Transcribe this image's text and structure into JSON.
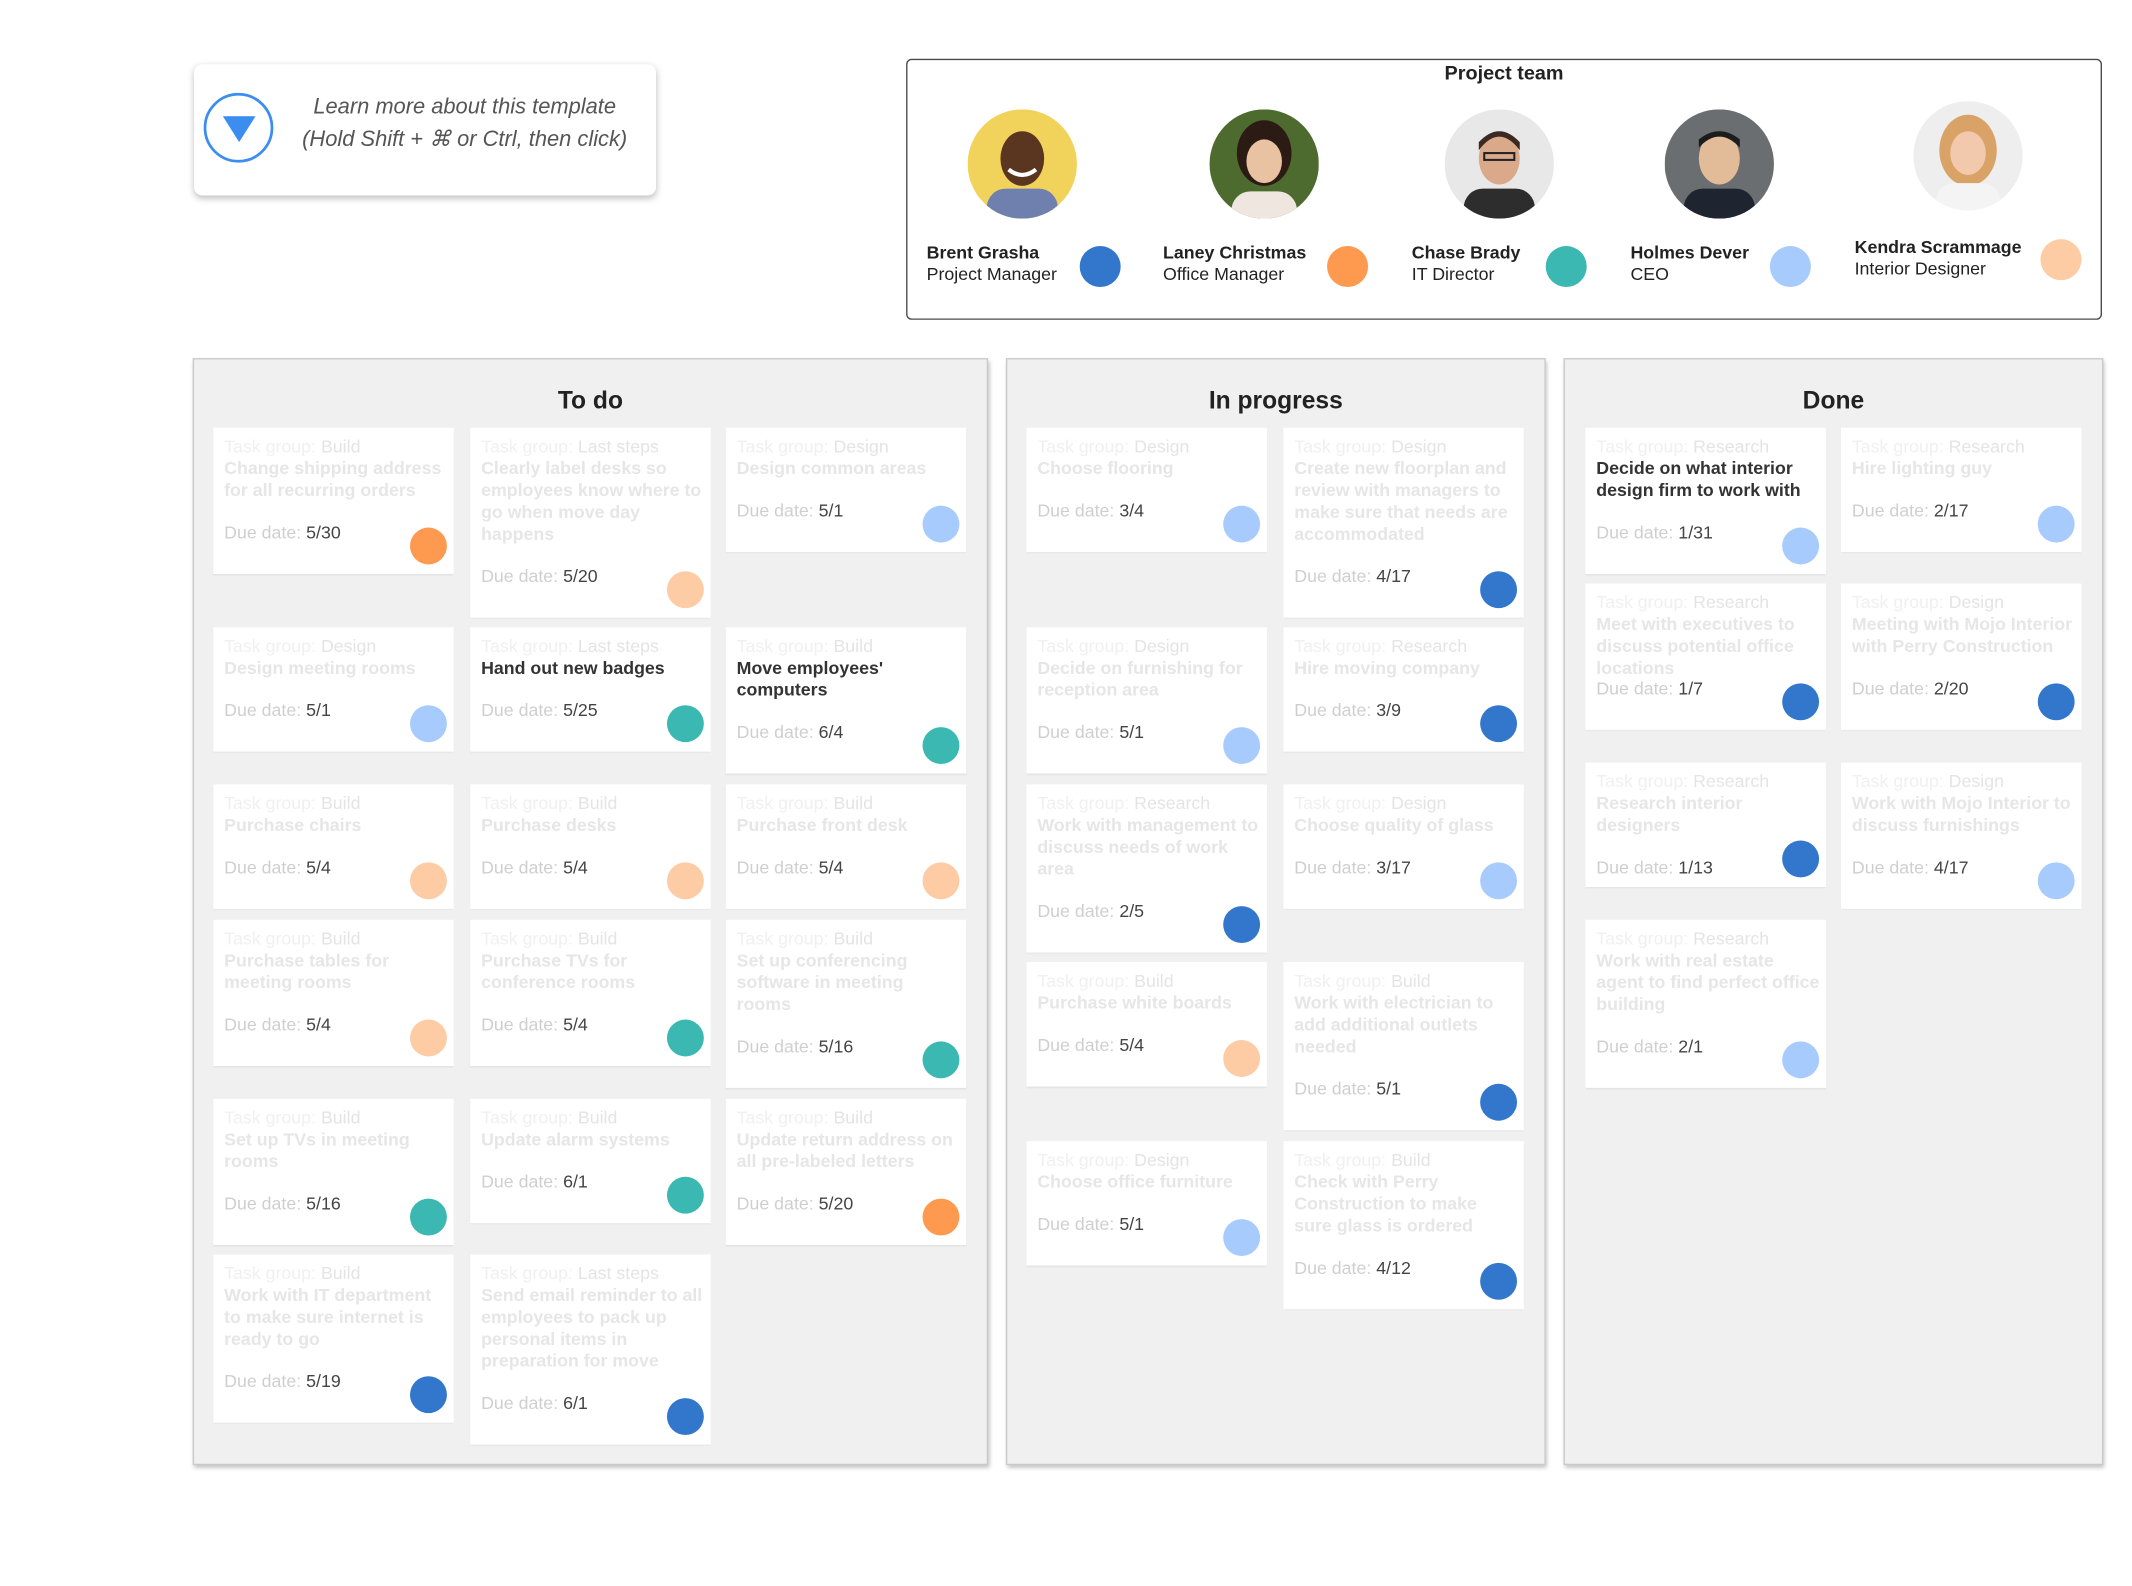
{
  "colors": {
    "dark_blue": "#3277cc",
    "orange": "#fd9a50",
    "teal": "#3cb8b2",
    "light_blue": "#a8cbfd",
    "peach": "#fdcba4"
  },
  "learn_more": {
    "line1": "Learn more about this template",
    "line2": "(Hold Shift + ⌘ or Ctrl, then click)",
    "icon": "triangle-down-icon"
  },
  "team": {
    "title": "Project team",
    "members": [
      {
        "name": "Brent Grasha",
        "role": "Project Manager",
        "color": "#3277cc"
      },
      {
        "name": "Laney Christmas",
        "role": "Office Manager",
        "color": "#fd9a50"
      },
      {
        "name": "Chase Brady",
        "role": "IT Director",
        "color": "#3cb8b2"
      },
      {
        "name": "Holmes Dever",
        "role": "CEO",
        "color": "#a8cbfd"
      },
      {
        "name": "Kendra Scrammage",
        "role": "Interior Designer",
        "color": "#fdcba4"
      }
    ]
  },
  "labels": {
    "group": "Task group:",
    "due": "Due date:"
  },
  "columns": [
    {
      "title": "To do",
      "cards": [
        {
          "group": "Build",
          "title": "Change shipping address for all recurring orders",
          "due": "5/30",
          "color": "#fd9a50"
        },
        {
          "group": "Last steps",
          "title": "Clearly label desks so employees know where to go when move day happens",
          "due": "5/20",
          "color": "#fdcba4"
        },
        {
          "group": "Design",
          "title": "Design common areas",
          "due": "5/1",
          "color": "#a8cbfd"
        },
        {
          "group": "Design",
          "title": "Design meeting rooms",
          "due": "5/1",
          "color": "#a8cbfd"
        },
        {
          "group": "Last steps",
          "title": "Hand out new badges",
          "due": "5/25",
          "color": "#3cb8b2"
        },
        {
          "group": "Build",
          "title": "Move employees' computers",
          "due": "6/4",
          "color": "#3cb8b2"
        },
        {
          "group": "Build",
          "title": "Purchase chairs",
          "due": "5/4",
          "color": "#fdcba4"
        },
        {
          "group": "Build",
          "title": "Purchase desks",
          "due": "5/4",
          "color": "#fdcba4"
        },
        {
          "group": "Build",
          "title": "Purchase front desk",
          "due": "5/4",
          "color": "#fdcba4"
        },
        {
          "group": "Build",
          "title": "Purchase tables for meeting rooms",
          "due": "5/4",
          "color": "#fdcba4"
        },
        {
          "group": "Build",
          "title": "Purchase TVs for conference rooms",
          "due": "5/4",
          "color": "#3cb8b2"
        },
        {
          "group": "Build",
          "title": "Set up conferencing software in meeting rooms",
          "due": "5/16",
          "color": "#3cb8b2"
        },
        {
          "group": "Build",
          "title": "Set up TVs in meeting rooms",
          "due": "5/16",
          "color": "#3cb8b2"
        },
        {
          "group": "Build",
          "title": "Update alarm systems",
          "due": "6/1",
          "color": "#3cb8b2"
        },
        {
          "group": "Build",
          "title": "Update return address on all pre-labeled letters",
          "due": "5/20",
          "color": "#fd9a50"
        },
        {
          "group": "Build",
          "title": "Work with IT department to make sure internet is ready to go",
          "due": "5/19",
          "color": "#3277cc"
        },
        {
          "group": "Last steps",
          "title": "Send email reminder to all employees to pack up personal items in preparation for move",
          "due": "6/1",
          "color": "#3277cc"
        }
      ]
    },
    {
      "title": "In progress",
      "cards": [
        {
          "group": "Design",
          "title": "Choose flooring",
          "due": "3/4",
          "color": "#a8cbfd"
        },
        {
          "group": "Design",
          "title": "Create new floorplan and review with managers to make sure that needs are accommodated",
          "due": "4/17",
          "color": "#3277cc"
        },
        {
          "group": "Design",
          "title": "Decide on furnishing for reception area",
          "due": "5/1",
          "color": "#a8cbfd"
        },
        {
          "group": "Research",
          "title": "Hire moving company",
          "due": "3/9",
          "color": "#3277cc"
        },
        {
          "group": "Research",
          "title": "Work with management to discuss needs of work area",
          "due": "2/5",
          "color": "#3277cc"
        },
        {
          "group": "Design",
          "title": "Choose quality of glass",
          "due": "3/17",
          "color": "#a8cbfd"
        },
        {
          "group": "Build",
          "title": "Purchase white boards",
          "due": "5/4",
          "color": "#fdcba4"
        },
        {
          "group": "Build",
          "title": "Work with electrician to add additional outlets needed",
          "due": "5/1",
          "color": "#3277cc"
        },
        {
          "group": "Design",
          "title": "Choose office furniture",
          "due": "5/1",
          "color": "#a8cbfd"
        },
        {
          "group": "Build",
          "title": "Check with Perry Construction to make sure glass is ordered",
          "due": "4/12",
          "color": "#3277cc"
        }
      ]
    },
    {
      "title": "Done",
      "cards": [
        {
          "group": "Research",
          "title": "Decide on what interior design firm to work with",
          "due": "1/31",
          "color": "#a8cbfd"
        },
        {
          "group": "Research",
          "title": "Hire lighting guy",
          "due": "2/17",
          "color": "#a8cbfd"
        },
        {
          "group": "Research",
          "title": "Meet with executives to discuss potential office locations",
          "due": "1/7",
          "color": "#3277cc"
        },
        {
          "group": "Design",
          "title": "Meeting with Mojo Interior with Perry Construction",
          "due": "2/20",
          "color": "#3277cc"
        },
        {
          "group": "Research",
          "title": "Research interior designers",
          "due": "1/13",
          "color": "#3277cc"
        },
        {
          "group": "Design",
          "title": "Work with Mojo Interior to discuss furnishings",
          "due": "4/17",
          "color": "#a8cbfd"
        },
        {
          "group": "Research",
          "title": "Work with real estate agent to find perfect office building",
          "due": "2/1",
          "color": "#a8cbfd"
        }
      ]
    }
  ]
}
